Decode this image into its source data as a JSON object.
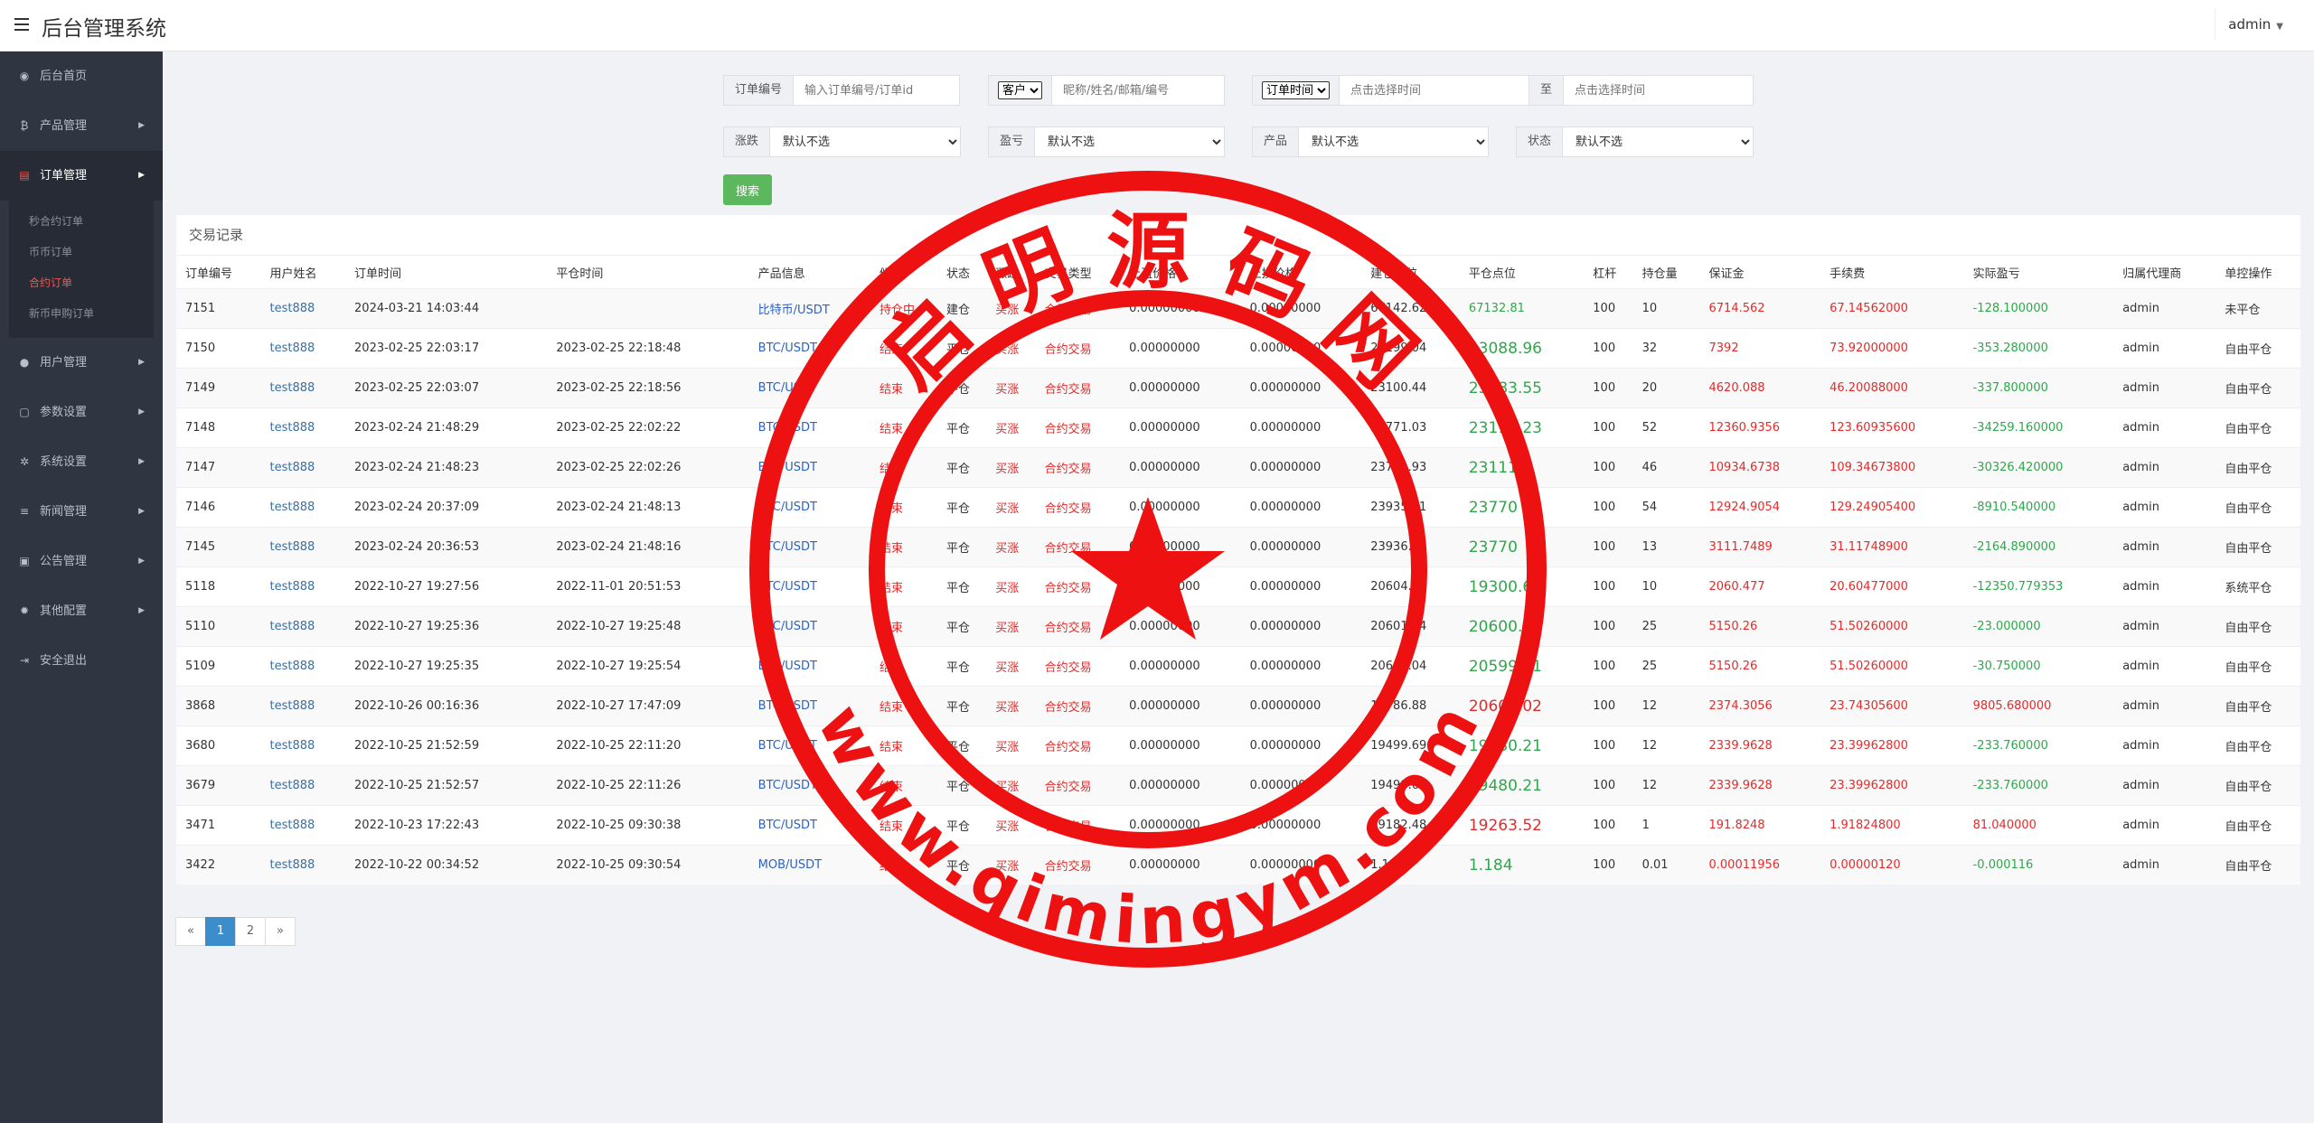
{
  "app": {
    "title": "后台管理系统",
    "user": "admin"
  },
  "sidebar": {
    "items": [
      {
        "label": "后台首页",
        "icon": "dashboard-icon",
        "glyph": "◉"
      },
      {
        "label": "产品管理",
        "icon": "bitcoin-icon",
        "glyph": "₿"
      },
      {
        "label": "订单管理",
        "icon": "file-icon",
        "glyph": "▤"
      },
      {
        "label": "用户管理",
        "icon": "user-icon",
        "glyph": "●"
      },
      {
        "label": "参数设置",
        "icon": "document-icon",
        "glyph": "▢"
      },
      {
        "label": "系统设置",
        "icon": "gears-icon",
        "glyph": "✲"
      },
      {
        "label": "新闻管理",
        "icon": "list-icon",
        "glyph": "≡"
      },
      {
        "label": "公告管理",
        "icon": "panel-icon",
        "glyph": "▣"
      },
      {
        "label": "其他配置",
        "icon": "gear-icon",
        "glyph": "✹"
      },
      {
        "label": "安全退出",
        "icon": "logout-icon",
        "glyph": "⇥"
      }
    ],
    "order_sub": [
      "秒合约订单",
      "币币订单",
      "合约订单",
      "新币申购订单"
    ]
  },
  "filters": {
    "order_no_label": "订单编号",
    "order_no_placeholder": "输入订单编号/订单id",
    "customer_select": "客户",
    "customer_placeholder": "昵称/姓名/邮箱/编号",
    "time_select": "订单时间",
    "time_start_placeholder": "点击选择时间",
    "time_to": "至",
    "time_end_placeholder": "点击选择时间",
    "updown_label": "涨跌",
    "profit_label": "盈亏",
    "product_label": "产品",
    "status_label": "状态",
    "default_option": "默认不选",
    "search_label": "搜索"
  },
  "table": {
    "title": "交易记录",
    "columns": [
      "订单编号",
      "用户姓名",
      "订单时间",
      "平仓时间",
      "产品信息",
      "倾向",
      "状态",
      "涨跌",
      "交易类型",
      "止盈价格",
      "止损价格",
      "建仓点位",
      "平仓点位",
      "杠杆",
      "持仓量",
      "保证金",
      "手续费",
      "实际盈亏",
      "归属代理商",
      "单控操作"
    ],
    "rows": [
      [
        "7151",
        "test888",
        "2024-03-21 14:03:44",
        "",
        "比特币/USDT",
        "持仓中",
        "建仓",
        "买涨",
        "合约交易",
        "0.00000000",
        "0.00000000",
        "67142.62",
        "67132.81",
        "100",
        "10",
        "6714.562",
        "67.14562000",
        "-128.100000",
        "admin",
        "未平仓"
      ],
      [
        "7150",
        "test888",
        "2023-02-25 22:03:17",
        "2023-02-25 22:18:48",
        "BTC/USDT",
        "结束",
        "平仓",
        "买涨",
        "合约交易",
        "0.00000000",
        "0.00000000",
        "23199.04",
        "23088.96",
        "100",
        "32",
        "7392",
        "73.92000000",
        "-353.280000",
        "admin",
        "自由平仓"
      ],
      [
        "7149",
        "test888",
        "2023-02-25 22:03:07",
        "2023-02-25 22:18:56",
        "BTC/USDT",
        "结束",
        "平仓",
        "买涨",
        "合约交易",
        "0.00000000",
        "0.00000000",
        "23100.44",
        "23083.55",
        "100",
        "20",
        "4620.088",
        "46.20088000",
        "-337.800000",
        "admin",
        "自由平仓"
      ],
      [
        "7148",
        "test888",
        "2023-02-24 21:48:29",
        "2023-02-25 22:02:22",
        "BTC/USDT",
        "结束",
        "平仓",
        "买涨",
        "合约交易",
        "0.00000000",
        "0.00000000",
        "23771.03",
        "23112.23",
        "100",
        "52",
        "12360.9356",
        "123.60935600",
        "-34259.160000",
        "admin",
        "自由平仓"
      ],
      [
        "7147",
        "test888",
        "2023-02-24 21:48:23",
        "2023-02-25 22:02:26",
        "BTC/USDT",
        "结束",
        "平仓",
        "买涨",
        "合约交易",
        "0.00000000",
        "0.00000000",
        "23771.93",
        "23111.7",
        "100",
        "46",
        "10934.6738",
        "109.34673800",
        "-30326.420000",
        "admin",
        "自由平仓"
      ],
      [
        "7146",
        "test888",
        "2023-02-24 20:37:09",
        "2023-02-24 21:48:13",
        "BTC/USDT",
        "结束",
        "平仓",
        "买涨",
        "合约交易",
        "0.00000000",
        "0.00000000",
        "23935.01",
        "23770",
        "100",
        "54",
        "12924.9054",
        "129.24905400",
        "-8910.540000",
        "admin",
        "自由平仓"
      ],
      [
        "7145",
        "test888",
        "2023-02-24 20:36:53",
        "2023-02-24 21:48:16",
        "BTC/USDT",
        "结束",
        "平仓",
        "买涨",
        "合约交易",
        "0.00000000",
        "0.00000000",
        "23936.53",
        "23770",
        "100",
        "13",
        "3111.7489",
        "31.11748900",
        "-2164.890000",
        "admin",
        "自由平仓"
      ],
      [
        "5118",
        "test888",
        "2022-10-27 19:27:56",
        "2022-11-01 20:51:53",
        "BTC/USDT",
        "结束",
        "平仓",
        "买涨",
        "合约交易",
        "0.00000000",
        "0.00000000",
        "20604.77",
        "19300.67",
        "100",
        "10",
        "2060.477",
        "20.60477000",
        "-12350.779353",
        "admin",
        "系统平仓"
      ],
      [
        "5110",
        "test888",
        "2022-10-27 19:25:36",
        "2022-10-27 19:25:48",
        "BTC/USDT",
        "结束",
        "平仓",
        "买涨",
        "合约交易",
        "0.00000000",
        "0.00000000",
        "20601.04",
        "20600.12",
        "100",
        "25",
        "5150.26",
        "51.50260000",
        "-23.000000",
        "admin",
        "自由平仓"
      ],
      [
        "5109",
        "test888",
        "2022-10-27 19:25:35",
        "2022-10-27 19:25:54",
        "BTC/USDT",
        "结束",
        "平仓",
        "买涨",
        "合约交易",
        "0.00000000",
        "0.00000000",
        "20601.04",
        "20599.81",
        "100",
        "25",
        "5150.26",
        "51.50260000",
        "-30.750000",
        "admin",
        "自由平仓"
      ],
      [
        "3868",
        "test888",
        "2022-10-26 00:16:36",
        "2022-10-27 17:47:09",
        "BTC/USDT",
        "结束",
        "平仓",
        "买涨",
        "合约交易",
        "0.00000000",
        "0.00000000",
        "19786.88",
        "20605.02",
        "100",
        "12",
        "2374.3056",
        "23.74305600",
        "9805.680000",
        "admin",
        "自由平仓"
      ],
      [
        "3680",
        "test888",
        "2022-10-25 21:52:59",
        "2022-10-25 22:11:20",
        "BTC/USDT",
        "结束",
        "平仓",
        "买涨",
        "合约交易",
        "0.00000000",
        "0.00000000",
        "19499.69",
        "19480.21",
        "100",
        "12",
        "2339.9628",
        "23.39962800",
        "-233.760000",
        "admin",
        "自由平仓"
      ],
      [
        "3679",
        "test888",
        "2022-10-25 21:52:57",
        "2022-10-25 22:11:26",
        "BTC/USDT",
        "结束",
        "平仓",
        "买涨",
        "合约交易",
        "0.00000000",
        "0.00000000",
        "19499.69",
        "19480.21",
        "100",
        "12",
        "2339.9628",
        "23.39962800",
        "-233.760000",
        "admin",
        "自由平仓"
      ],
      [
        "3471",
        "test888",
        "2022-10-23 17:22:43",
        "2022-10-25 09:30:38",
        "BTC/USDT",
        "结束",
        "平仓",
        "买涨",
        "合约交易",
        "0.00000000",
        "0.00000000",
        "19182.48",
        "19263.52",
        "100",
        "1",
        "191.8248",
        "1.91824800",
        "81.040000",
        "admin",
        "自由平仓"
      ],
      [
        "3422",
        "test888",
        "2022-10-22 00:34:52",
        "2022-10-25 09:30:54",
        "MOB/USDT",
        "结束",
        "平仓",
        "买涨",
        "合约交易",
        "0.00000000",
        "0.00000000",
        "1.1956",
        "1.184",
        "100",
        "0.01",
        "0.00011956",
        "0.00000120",
        "-0.000116",
        "admin",
        "自由平仓"
      ]
    ]
  },
  "pagination": {
    "prev": "«",
    "pages": [
      "1",
      "2"
    ],
    "next": "»",
    "current": "1"
  },
  "watermark": {
    "top_text": "启 明 源 码 网",
    "bottom_text": "www.qimingym.com",
    "color": "#ee1111"
  }
}
